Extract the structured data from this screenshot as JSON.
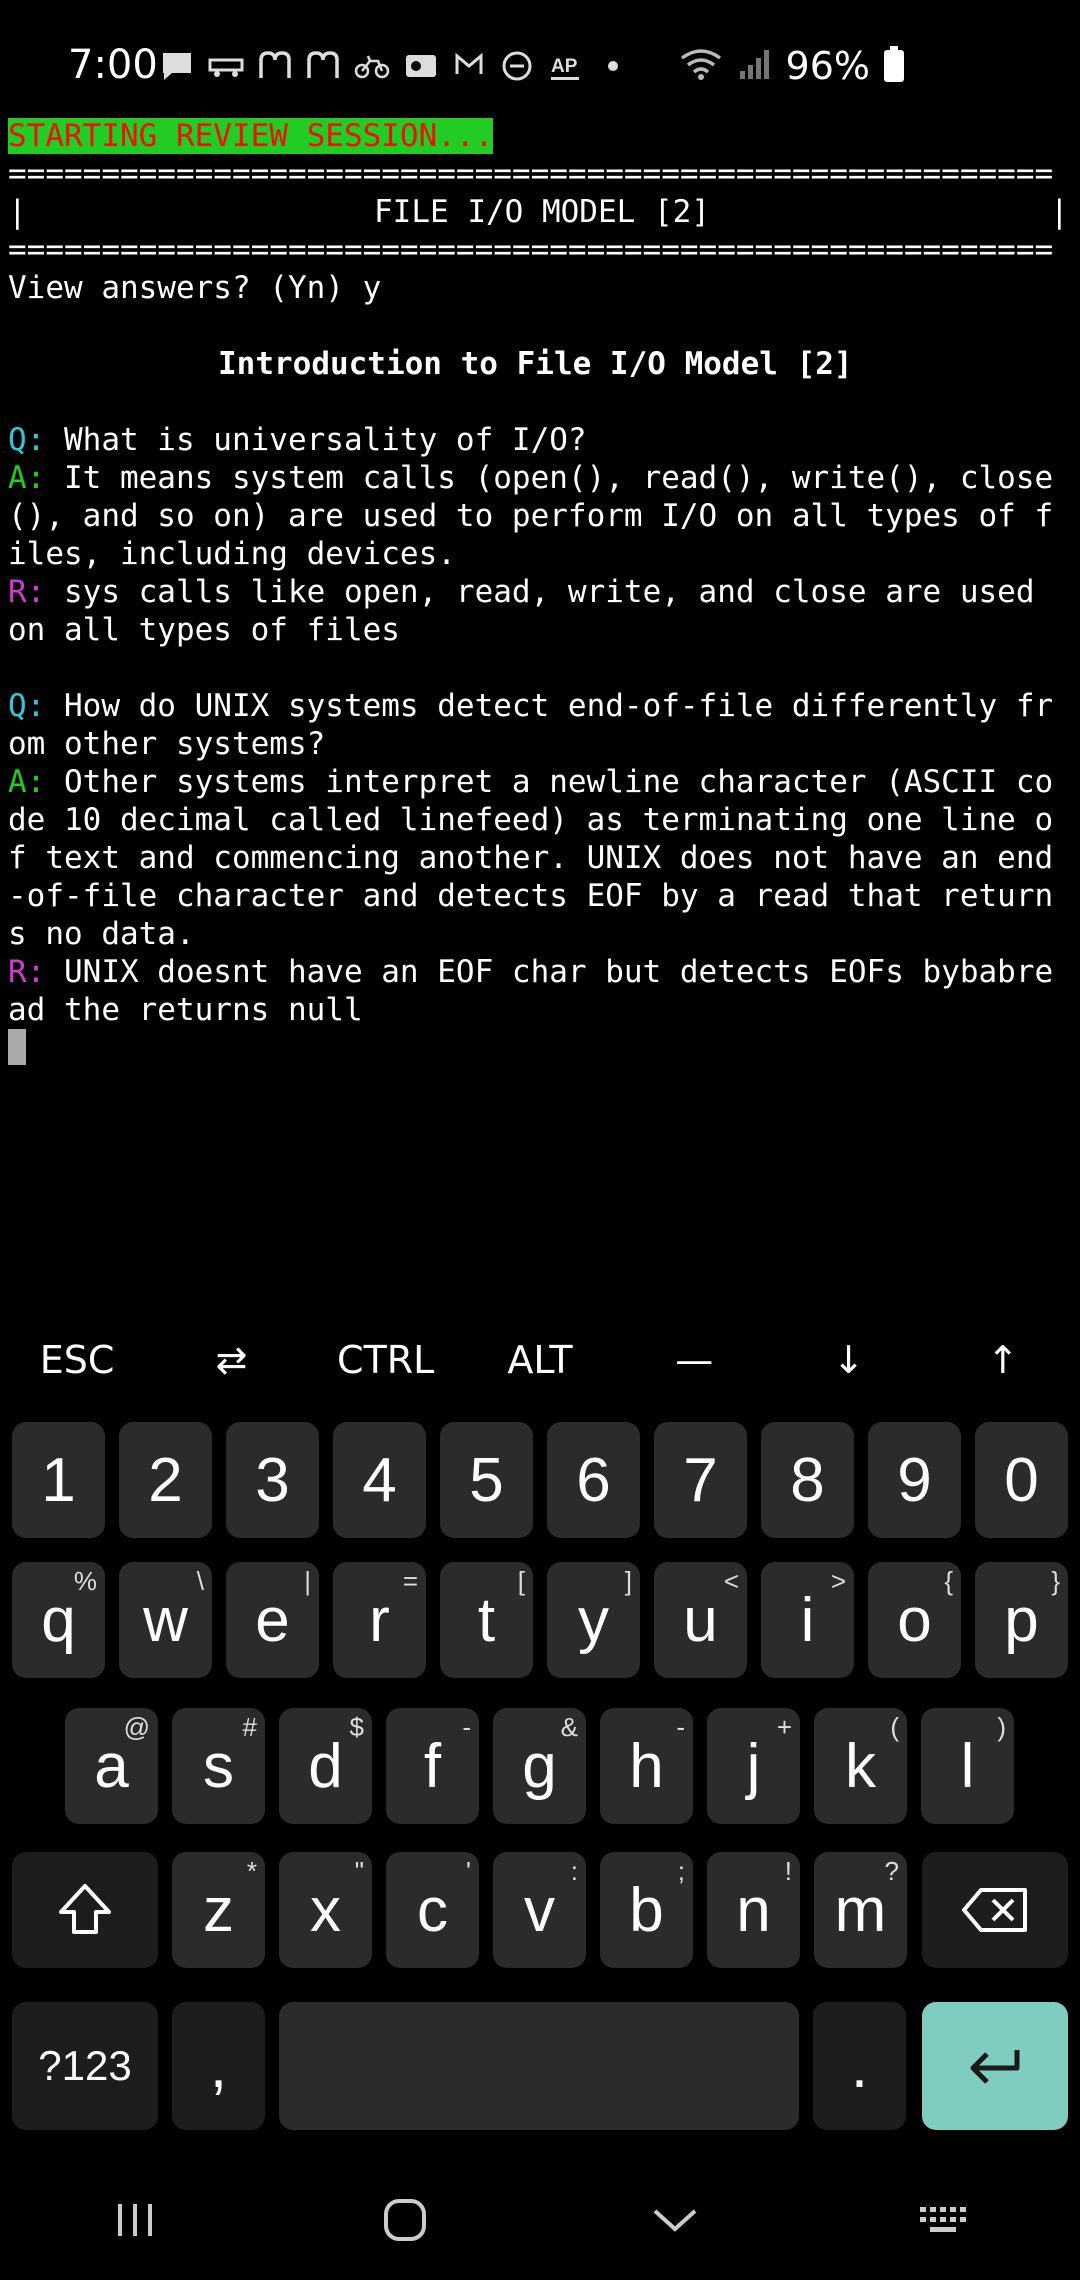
{
  "status_bar": {
    "time": "7:00",
    "battery": "96%",
    "icons": [
      "message-icon",
      "delivery-icon",
      "mcdonalds-icon",
      "mcdonalds-icon",
      "bike-icon",
      "outlook-icon",
      "gmail-icon",
      "dnd-icon",
      "ap-news-icon",
      "dot-icon",
      "wifi-icon",
      "signal-icon",
      "battery-icon"
    ]
  },
  "terminal": {
    "banner": "STARTING REVIEW SESSION...",
    "rule": "========================================================",
    "header_left": "|",
    "header_title": "FILE I/O MODEL [2]",
    "header_right": "|",
    "prompt": "View answers? (Yn) y",
    "section_title": "Introduction to File I/O Model [2]",
    "q_tag": "Q:",
    "a_tag": "A:",
    "r_tag": "R:",
    "qa": [
      {
        "q": [
          "What is universality of I/O?"
        ],
        "a": [
          "It means system calls (open(), read(), write(), close",
          "(), and so on) are used to perform I/O on all types of f",
          "iles, including devices."
        ],
        "r": [
          "sys calls like open, read, write, and close are used",
          "on all types of files"
        ]
      },
      {
        "q": [
          "How do UNIX systems detect end-of-file differently fr",
          "om other systems?"
        ],
        "a": [
          "Other systems interpret a newline character (ASCII co",
          "de 10 decimal called linefeed) as terminating one line o",
          "f text and commencing another. UNIX does not have an end",
          "-of-file character and detects EOF by a read that return",
          "s no data."
        ],
        "r": [
          "UNIX doesnt have an EOF char but detects EOFs bybabre",
          "ad the returns null"
        ]
      }
    ]
  },
  "extra_keys": [
    "ESC",
    "⇄",
    "CTRL",
    "ALT",
    "—",
    "↓",
    "↑"
  ],
  "keyboard": {
    "row_numbers": [
      "1",
      "2",
      "3",
      "4",
      "5",
      "6",
      "7",
      "8",
      "9",
      "0"
    ],
    "row1": [
      [
        "q",
        "%"
      ],
      [
        "w",
        "\\"
      ],
      [
        "e",
        "|"
      ],
      [
        "r",
        "="
      ],
      [
        "t",
        "["
      ],
      [
        "y",
        "]"
      ],
      [
        "u",
        "<"
      ],
      [
        "i",
        ">"
      ],
      [
        "o",
        "{"
      ],
      [
        "p",
        "}"
      ]
    ],
    "row2": [
      [
        "a",
        "@"
      ],
      [
        "s",
        "#"
      ],
      [
        "d",
        "$"
      ],
      [
        "f",
        "-"
      ],
      [
        "g",
        "&"
      ],
      [
        "h",
        "-"
      ],
      [
        "j",
        "+"
      ],
      [
        "k",
        "("
      ],
      [
        "l",
        ")"
      ]
    ],
    "row3": [
      [
        "z",
        "*"
      ],
      [
        "x",
        "\""
      ],
      [
        "c",
        "'"
      ],
      [
        "v",
        ":"
      ],
      [
        "b",
        ";"
      ],
      [
        "n",
        "!"
      ],
      [
        "m",
        "?"
      ]
    ],
    "symbols_label": "?123",
    "comma": ",",
    "period": "."
  }
}
